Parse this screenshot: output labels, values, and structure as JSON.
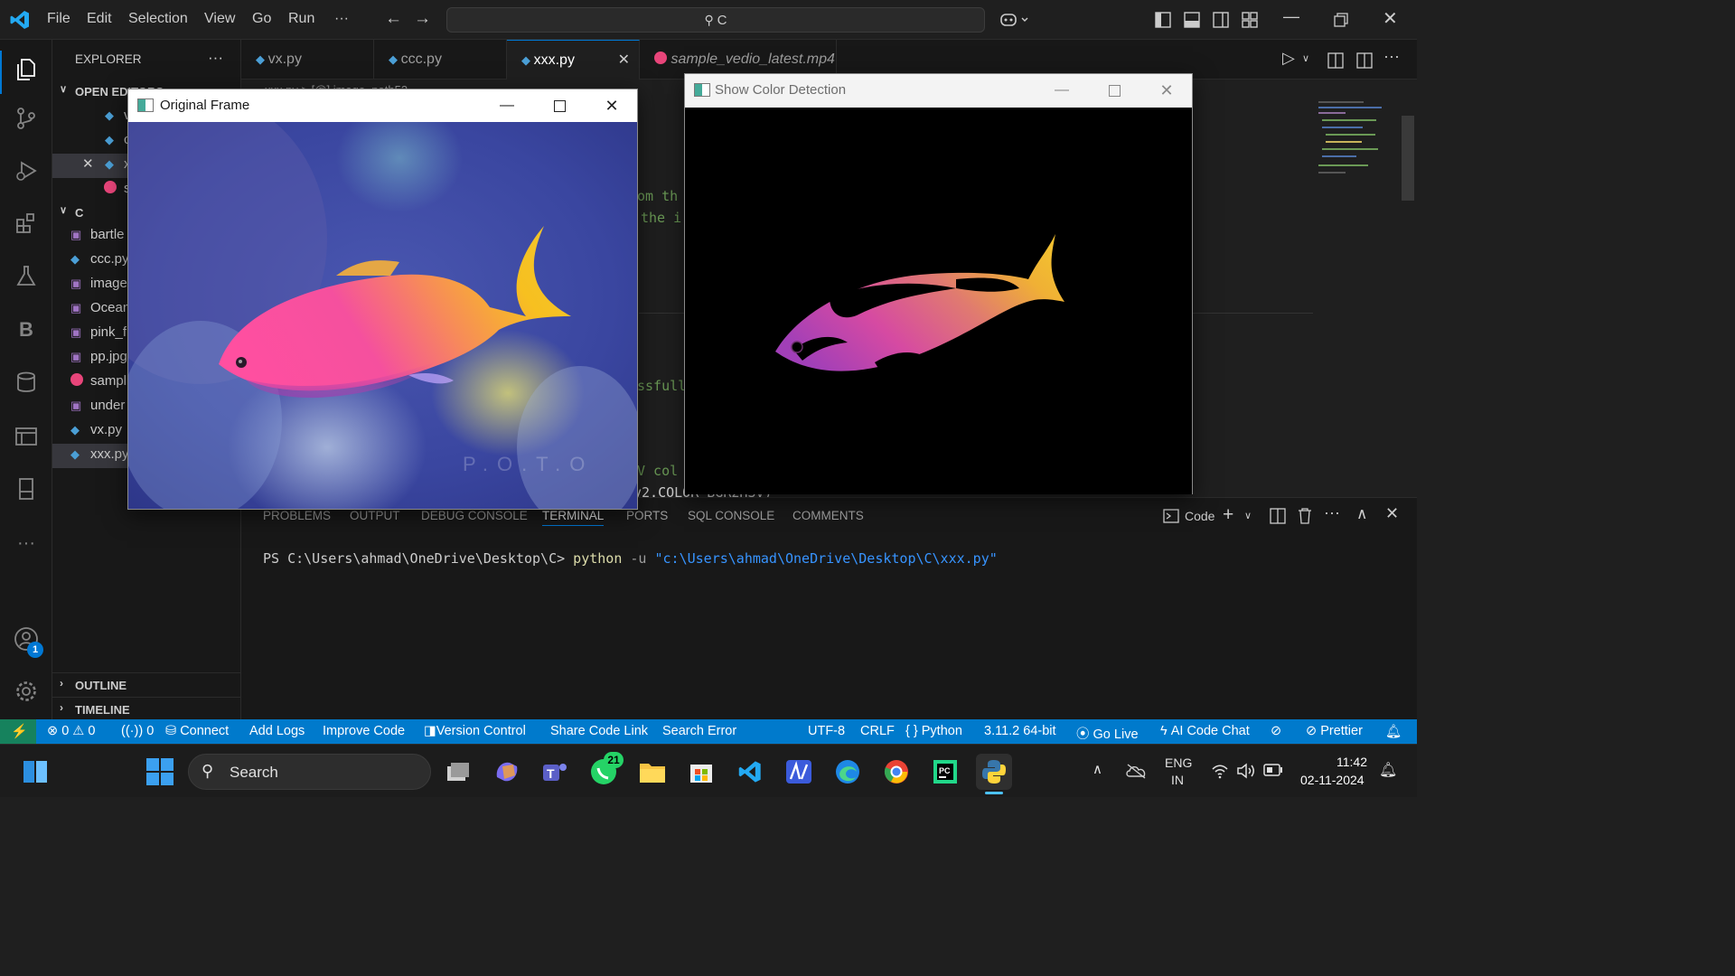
{
  "menu": {
    "file": "File",
    "edit": "Edit",
    "selection": "Selection",
    "view": "View",
    "go": "Go",
    "run": "Run",
    "more": "···"
  },
  "search": {
    "text": "C"
  },
  "sidebar": {
    "title": "EXPLORER",
    "open_editors": "OPEN EDITORS",
    "folder": "C",
    "files": [
      "bartle",
      "ccc.py",
      "image",
      "Ocean",
      "pink_f",
      "pp.jpg",
      "sampl",
      "under",
      "vx.py",
      "xxx.py"
    ],
    "outline": "OUTLINE",
    "timeline": "TIMELINE"
  },
  "tabs": [
    {
      "label": "vx.py"
    },
    {
      "label": "ccc.py"
    },
    {
      "label": "xxx.py"
    },
    {
      "label": "sample_vedio_latest.mp4"
    }
  ],
  "editor": {
    "breadcrumb": "xxx.py > [@] image_path52",
    "fragments": [
      "om th",
      "the i",
      "ssfull",
      "V col",
      "v2.COLOR_BGR2HSV)"
    ]
  },
  "panel": {
    "tabs": [
      "PROBLEMS",
      "OUTPUT",
      "DEBUG CONSOLE",
      "TERMINAL",
      "PORTS",
      "SQL CONSOLE",
      "COMMENTS"
    ],
    "active_tab": "TERMINAL",
    "shell_label": "Code",
    "terminal": {
      "prompt": "PS C:\\Users\\ahmad\\OneDrive\\Desktop\\C>",
      "cmd": "python",
      "flag": "-u",
      "path": "\"c:\\Users\\ahmad\\OneDrive\\Desktop\\C\\xxx.py\""
    }
  },
  "windows": {
    "original": {
      "title": "Original Frame",
      "watermark": "P.O.T.O"
    },
    "detect": {
      "title": "Show Color Detection"
    }
  },
  "status": {
    "errors": "0",
    "warnings": "0",
    "ports": "0",
    "connect": "Connect",
    "add_logs": "Add Logs",
    "improve": "Improve Code",
    "version": "Version Control",
    "share": "Share Code Link",
    "search_err": "Search Error",
    "encoding": "UTF-8",
    "eol": "CRLF",
    "lang": "Python",
    "interp": "3.11.2 64-bit",
    "golive": "Go Live",
    "ai": "AI Code Chat",
    "prettier": "Prettier"
  },
  "taskbar": {
    "search": "Search",
    "whatsapp_badge": "21",
    "lang1": "ENG",
    "lang2": "IN",
    "time": "11:42",
    "date": "02-11-2024"
  },
  "accounts_badge": "1",
  "colors": {
    "accent": "#007acc",
    "keyword": "#dcdcaa",
    "string": "#3794ff"
  }
}
